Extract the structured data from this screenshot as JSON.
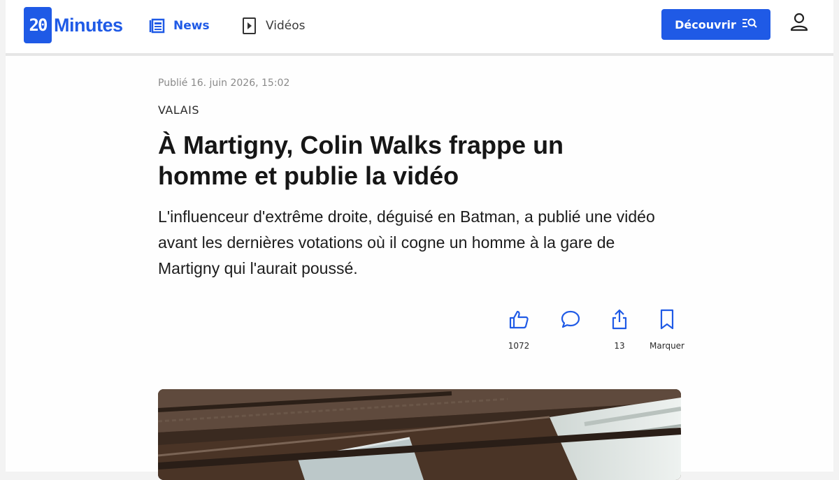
{
  "header": {
    "logo": {
      "mark": "20",
      "word": "Minutes"
    },
    "nav": [
      {
        "label": "News",
        "icon": "news-icon"
      },
      {
        "label": "Vidéos",
        "icon": "video-play-icon"
      }
    ],
    "cta_label": "Découvrir",
    "cta_icon": "search-list-icon",
    "user_icon": "user-icon"
  },
  "article": {
    "published": "Publié 16. juin 2026, 15:02",
    "category": "VALAIS",
    "title": "À Martigny, Colin Walks frappe un homme et publie la vidéo",
    "lead": "L'influenceur d'extrême droite, déguisé en Batman, a publié une vidéo avant les dernières votations où il cogne un homme à la gare de Martigny qui l'aurait poussé."
  },
  "actions": [
    {
      "icon": "thumbs-up-icon",
      "label": "1072"
    },
    {
      "icon": "comment-icon",
      "label": ""
    },
    {
      "icon": "share-icon",
      "label": "13"
    },
    {
      "icon": "bookmark-icon",
      "label": "Marquer"
    }
  ],
  "colors": {
    "accent": "#1f5ae6"
  }
}
